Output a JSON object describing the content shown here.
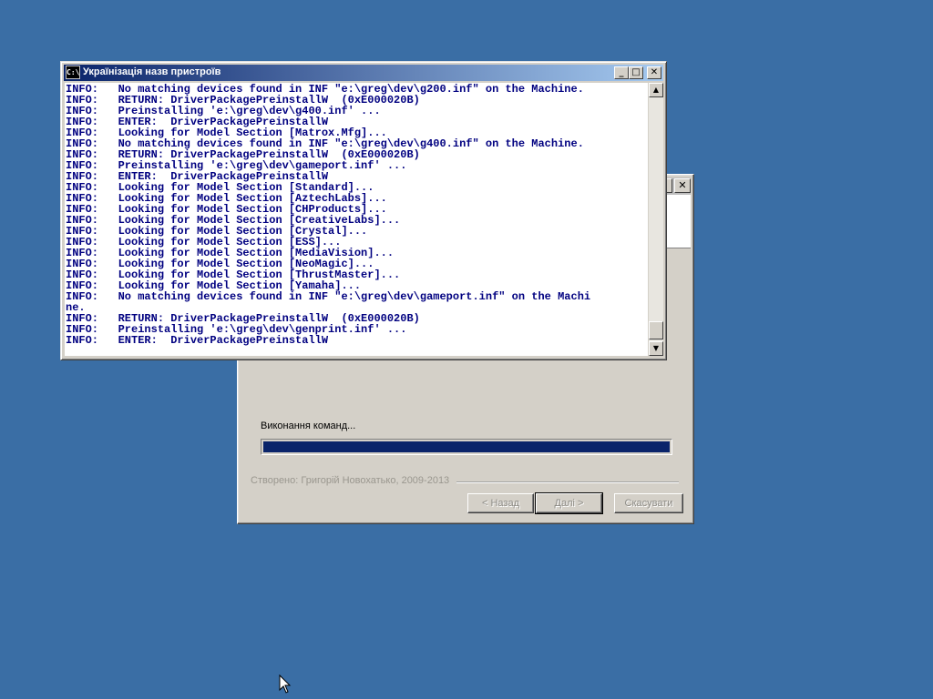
{
  "console": {
    "title": "Українізація назв пристроїв",
    "icon_label": "C:\\",
    "buttons": {
      "minimize": "_",
      "maximize": "□",
      "close": "✕"
    },
    "scroll": {
      "up": "▲",
      "down": "▼"
    },
    "lines": [
      "INFO:   No matching devices found in INF \"e:\\greg\\dev\\g200.inf\" on the Machine.",
      "INFO:   RETURN: DriverPackagePreinstallW  (0xE000020B)",
      "INFO:   Preinstalling 'e:\\greg\\dev\\g400.inf' ...",
      "INFO:   ENTER:  DriverPackagePreinstallW",
      "INFO:   Looking for Model Section [Matrox.Mfg]...",
      "INFO:   No matching devices found in INF \"e:\\greg\\dev\\g400.inf\" on the Machine.",
      "INFO:   RETURN: DriverPackagePreinstallW  (0xE000020B)",
      "INFO:   Preinstalling 'e:\\greg\\dev\\gameport.inf' ...",
      "INFO:   ENTER:  DriverPackagePreinstallW",
      "INFO:   Looking for Model Section [Standard]...",
      "INFO:   Looking for Model Section [AztechLabs]...",
      "INFO:   Looking for Model Section [CHProducts]...",
      "INFO:   Looking for Model Section [CreativeLabs]...",
      "INFO:   Looking for Model Section [Crystal]...",
      "INFO:   Looking for Model Section [ESS]...",
      "INFO:   Looking for Model Section [MediaVision]...",
      "INFO:   Looking for Model Section [NeoMagic]...",
      "INFO:   Looking for Model Section [ThrustMaster]...",
      "INFO:   Looking for Model Section [Yamaha]...",
      "INFO:   No matching devices found in INF \"e:\\greg\\dev\\gameport.inf\" on the Machi",
      "ne.",
      "INFO:   RETURN: DriverPackagePreinstallW  (0xE000020B)",
      "INFO:   Preinstalling 'e:\\greg\\dev\\genprint.inf' ...",
      "INFO:   ENTER:  DriverPackagePreinstallW"
    ]
  },
  "wizard": {
    "close_label": "✕",
    "status_text": "Виконання команд...",
    "progress": 1.0,
    "credits": "Створено: Григорій Новохатько, 2009-2013",
    "buttons": {
      "back": "< Назад",
      "next": "Далі >",
      "cancel": "Скасувати"
    }
  },
  "colors": {
    "desktop": "#3a6ea5",
    "console_text": "#000080",
    "progress_fill": "#0a246a",
    "title_active": "#0a246a"
  }
}
